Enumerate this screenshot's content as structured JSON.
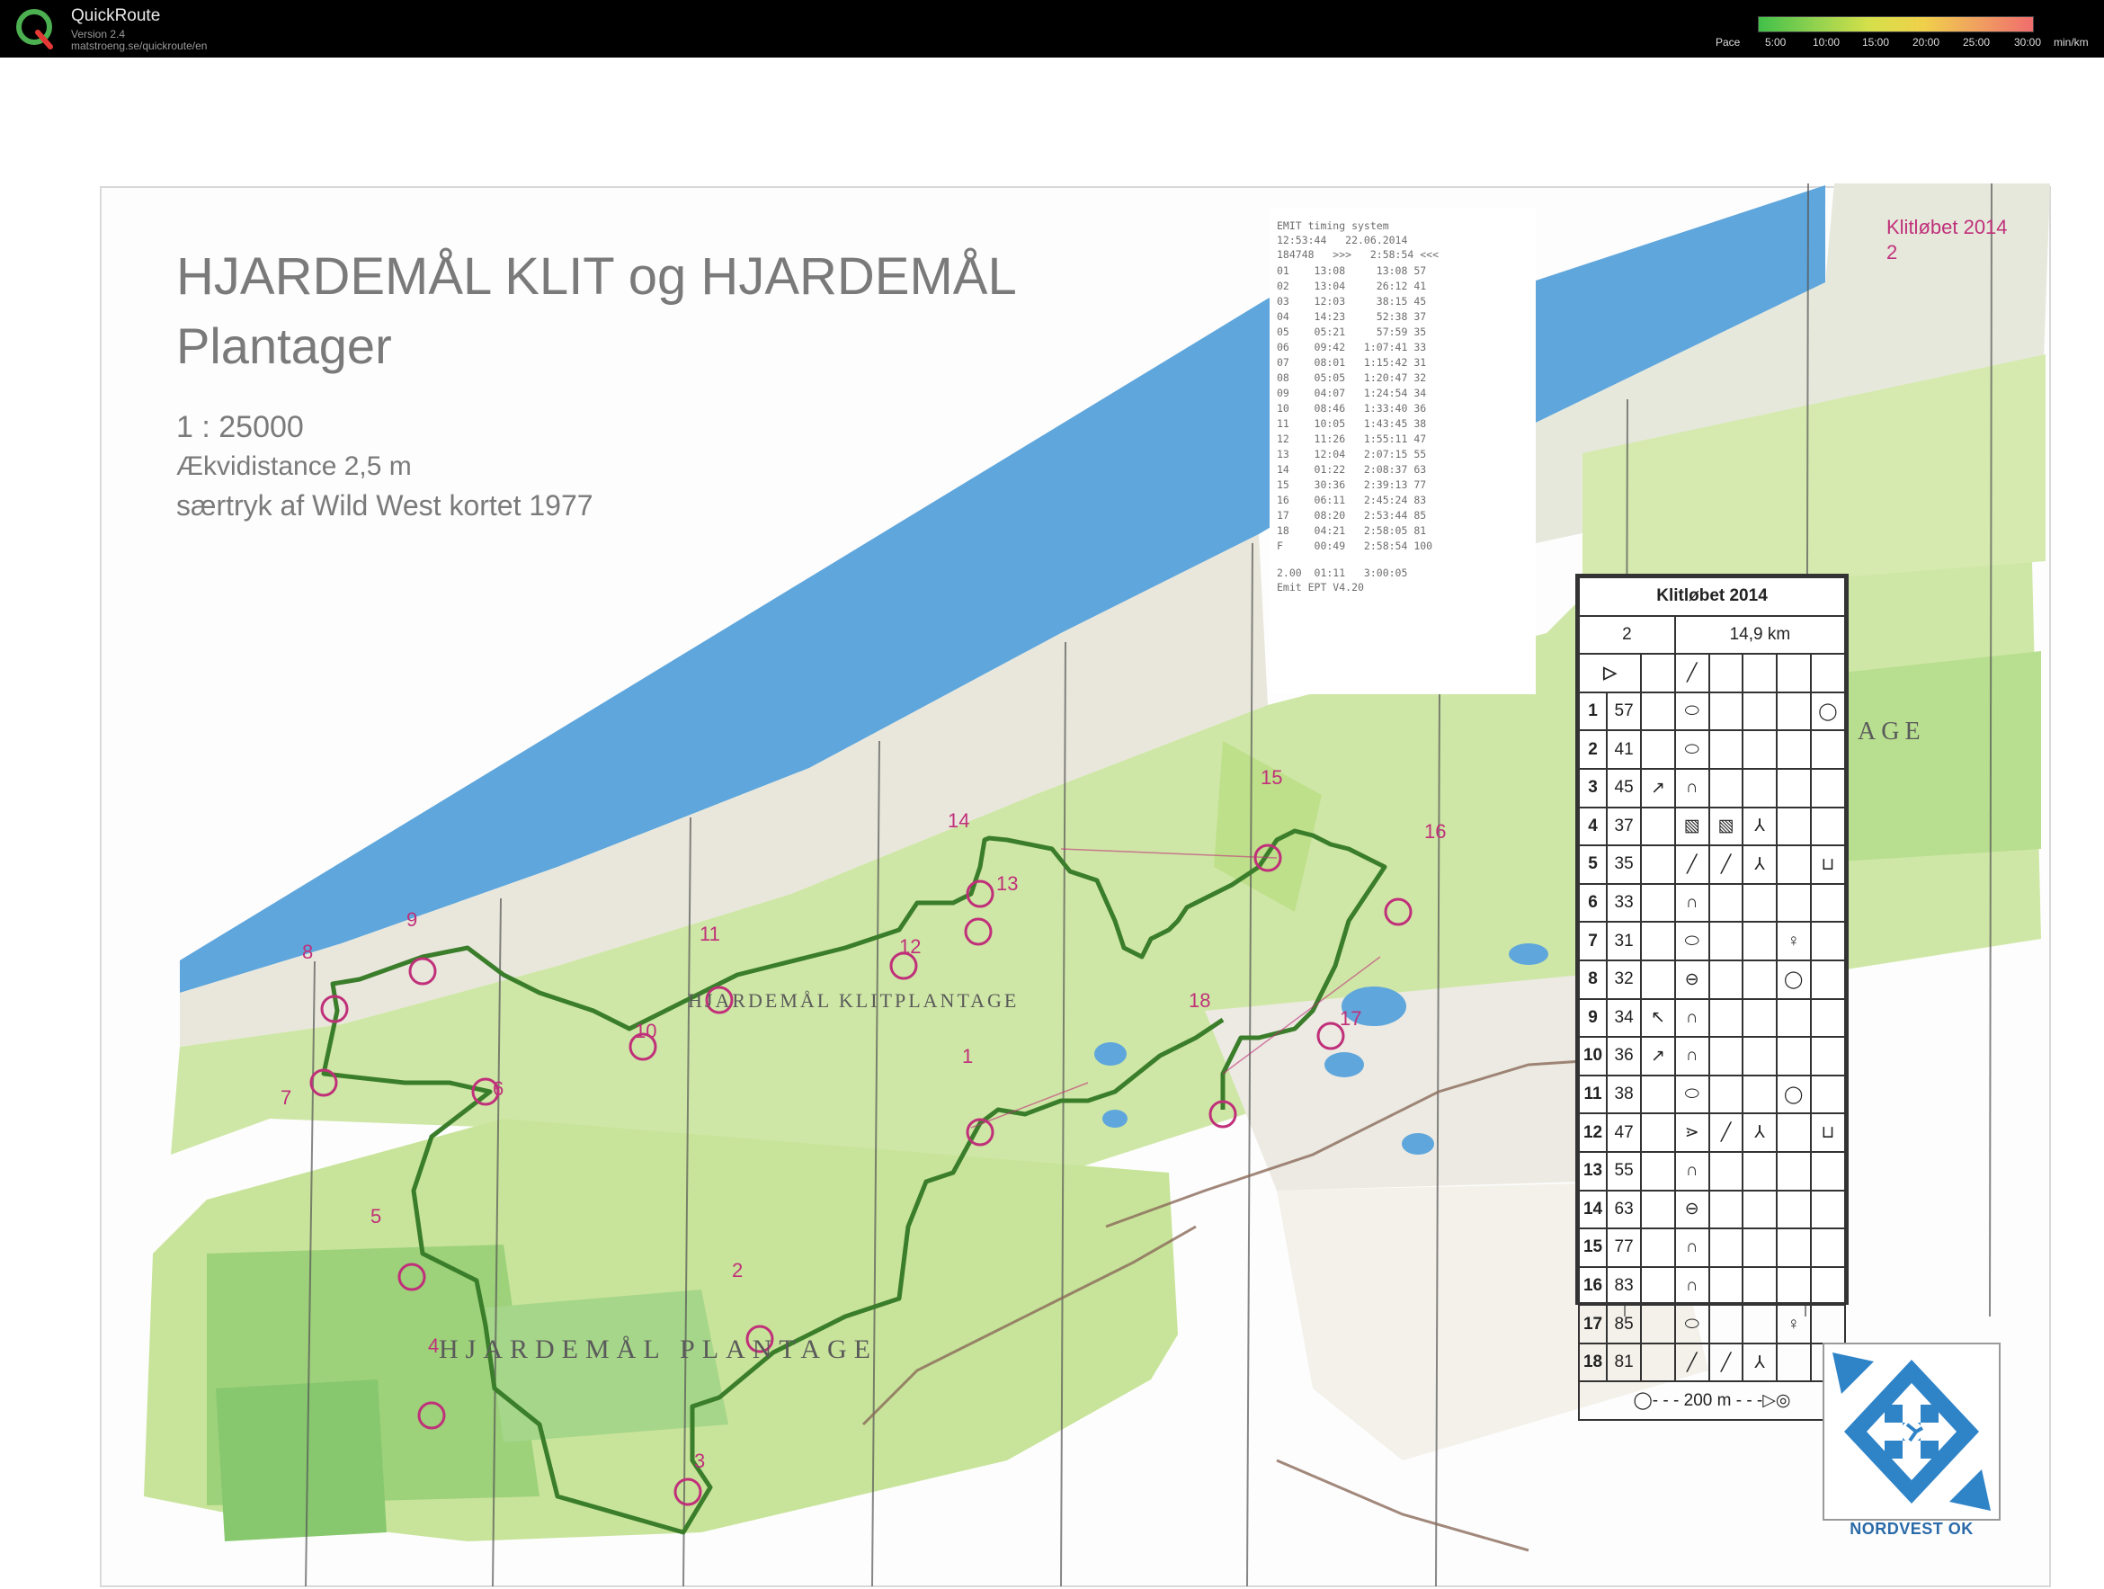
{
  "app": {
    "name": "QuickRoute",
    "version": "Version 2.4",
    "url": "matstroeng.se/quickroute/en"
  },
  "pace_scale": {
    "label": "Pace",
    "ticks": [
      "5:00",
      "10:00",
      "15:00",
      "20:00",
      "25:00",
      "30:00"
    ],
    "unit": "min/km",
    "colors": [
      "#41c04a",
      "#8fd14f",
      "#d4e04a",
      "#f0d04a",
      "#f0a060",
      "#f06d6d"
    ]
  },
  "map": {
    "title_line1": "HJARDEMÅL KLIT og HJARDEMÅL",
    "title_line2": "Plantager",
    "scale": "1 : 25000",
    "contour": "Ækvidistance 2,5 m",
    "reprint": "særtryk af Wild West kortet 1977",
    "corner_label": "Klitløbet 2014",
    "corner_course": "2",
    "area_labels": [
      "HJARDEMÅL KLITPLANTAGE",
      "HJARDEMÅL PLANTAGE",
      "AGE"
    ],
    "control_labels": [
      "1",
      "2",
      "3",
      "4",
      "5",
      "6",
      "7",
      "8",
      "9",
      "10",
      "11",
      "12",
      "13",
      "14",
      "15",
      "16",
      "17",
      "18"
    ]
  },
  "splits": {
    "header1": "EMIT timing system",
    "header2": "12:53:44   22.06.2014",
    "header3": "184748   >>>   2:58:54 <<<",
    "rows": [
      "01    13:08     13:08 57",
      "02    13:04     26:12 41",
      "03    12:03     38:15 45",
      "04    14:23     52:38 37",
      "05    05:21     57:59 35",
      "06    09:42   1:07:41 33",
      "07    08:01   1:15:42 31",
      "08    05:05   1:20:47 32",
      "09    04:07   1:24:54 34",
      "10    08:46   1:33:40 36",
      "11    10:05   1:43:45 38",
      "12    11:26   1:55:11 47",
      "13    12:04   2:07:15 55",
      "14    01:22   2:08:37 63",
      "15    30:36   2:39:13 77",
      "16    06:11   2:45:24 83",
      "17    08:20   2:53:44 85",
      "18    04:21   2:58:05 81",
      "F     00:49   2:58:54 100"
    ],
    "footer1": "2.00  01:11   3:00:05",
    "footer2": "Emit EPT V4.20"
  },
  "description": {
    "title": "Klitløbet 2014",
    "course": "2",
    "length": "14,9 km",
    "rows": [
      {
        "n": "1",
        "code": "57",
        "sym": "⬭",
        "extra": "◯"
      },
      {
        "n": "2",
        "code": "41",
        "sym": "⬭",
        "extra": ""
      },
      {
        "n": "3",
        "code": "45",
        "sym": "∩",
        "extra": ""
      },
      {
        "n": "4",
        "code": "37",
        "sym": "▧",
        "extra": ""
      },
      {
        "n": "5",
        "code": "35",
        "sym": "╱",
        "extra": "⊔"
      },
      {
        "n": "6",
        "code": "33",
        "sym": "∩",
        "extra": ""
      },
      {
        "n": "7",
        "code": "31",
        "sym": "⬭",
        "extra": "♀"
      },
      {
        "n": "8",
        "code": "32",
        "sym": "⊖",
        "extra": "◯"
      },
      {
        "n": "9",
        "code": "34",
        "sym": "∩",
        "extra": ""
      },
      {
        "n": "10",
        "code": "36",
        "sym": "∩",
        "extra": ""
      },
      {
        "n": "11",
        "code": "38",
        "sym": "⬭",
        "extra": "◯"
      },
      {
        "n": "12",
        "code": "47",
        "sym": "⋗",
        "extra": "⊔"
      },
      {
        "n": "13",
        "code": "55",
        "sym": "∩",
        "extra": ""
      },
      {
        "n": "14",
        "code": "63",
        "sym": "⊖",
        "extra": ""
      },
      {
        "n": "15",
        "code": "77",
        "sym": "∩",
        "extra": ""
      },
      {
        "n": "16",
        "code": "83",
        "sym": "∩",
        "extra": ""
      },
      {
        "n": "17",
        "code": "85",
        "sym": "⬭",
        "extra": "♀"
      },
      {
        "n": "18",
        "code": "81",
        "sym": "╱",
        "extra": ""
      }
    ],
    "finish": "◯- - - 200 m - - -▷◎"
  },
  "club": {
    "name": "NORDVEST OK"
  }
}
